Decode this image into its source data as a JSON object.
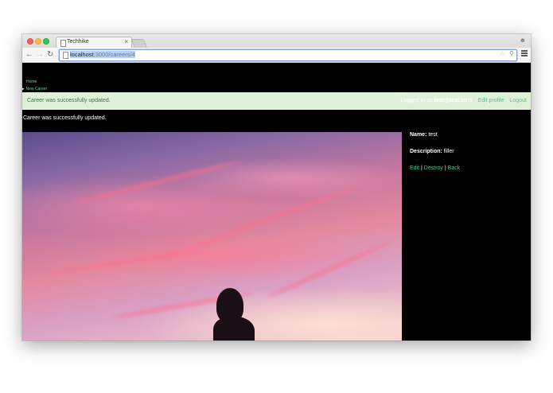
{
  "browser": {
    "tab_title": "Techhike",
    "tab_close": "×",
    "url_host": "localhost",
    "url_path": ":3000/careers/4"
  },
  "nav": {
    "home": "Home",
    "new_career": "New Career"
  },
  "flash": {
    "message": "Career was successfully updated.",
    "logged_in_prefix": "Logged in as",
    "logged_in_user": "test@test.com",
    "edit_profile": "Edit profile",
    "logout": "Logout"
  },
  "notice": "Career was successfully updated.",
  "career": {
    "name_label": "Name:",
    "name_value": "test",
    "description_label": "Description:",
    "description_value": "filler"
  },
  "actions": {
    "edit": "Edit",
    "destroy": "Destroy",
    "back": "Back",
    "separator": "|"
  },
  "icons": [
    "page-icon",
    "back-arrow-icon",
    "forward-arrow-icon",
    "reload-icon",
    "star-icon",
    "search-icon",
    "menu-icon",
    "profile-icon"
  ],
  "colors": {
    "link_green": "#4fc57d",
    "flash_bg": "#e0f1da",
    "flash_text": "#3c763d",
    "page_bg": "#000000"
  }
}
